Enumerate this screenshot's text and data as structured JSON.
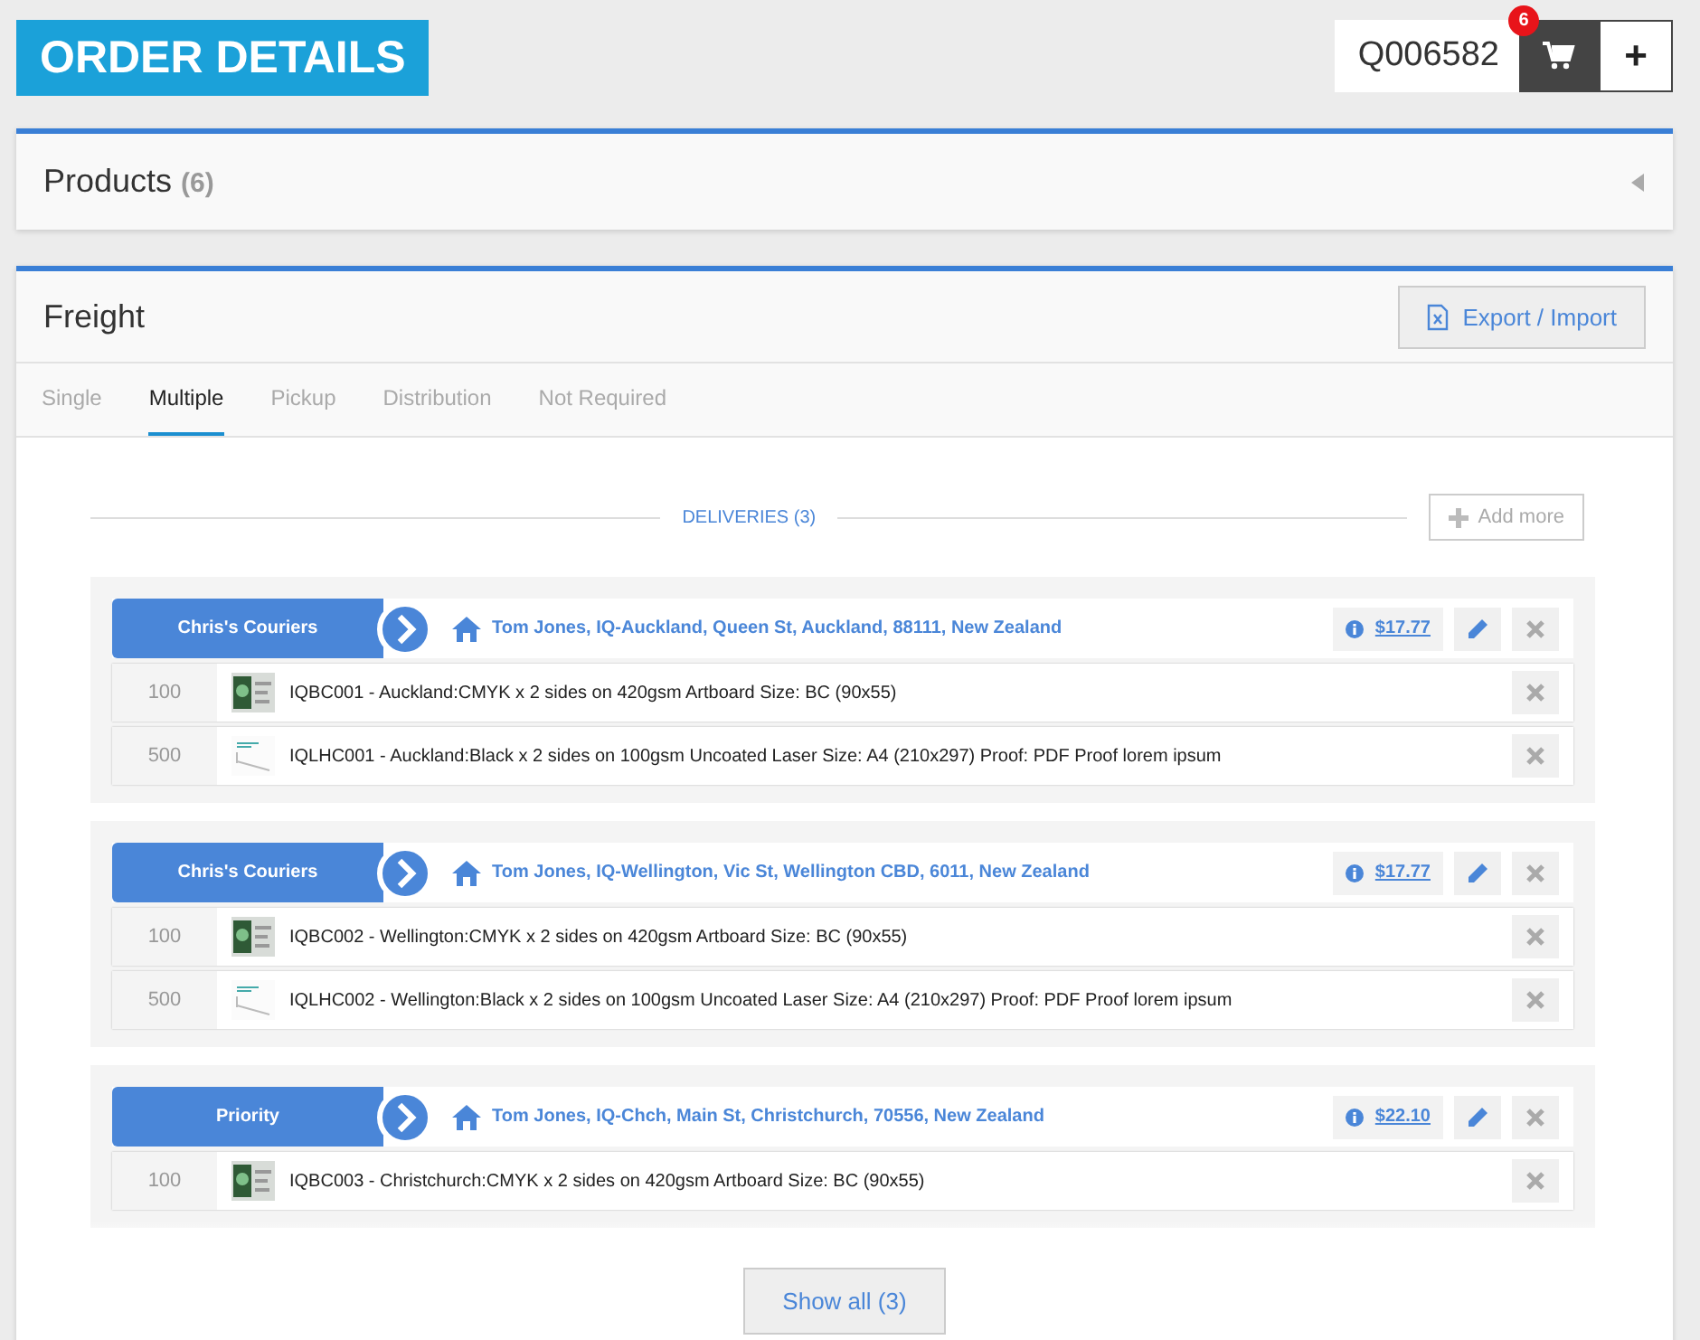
{
  "header": {
    "title": "ORDER DETAILS",
    "quote_number": "Q006582",
    "cart_count": "6",
    "add_label": "+"
  },
  "products_panel": {
    "title": "Products",
    "count": "(6)",
    "expanded": false
  },
  "freight_panel": {
    "title": "Freight",
    "export_button": "Export / Import",
    "tabs": [
      {
        "label": "Single",
        "selected": false
      },
      {
        "label": "Multiple",
        "selected": true
      },
      {
        "label": "Pickup",
        "selected": false
      },
      {
        "label": "Distribution",
        "selected": false
      },
      {
        "label": "Not Required",
        "selected": false
      }
    ],
    "deliveries_label": "DELIVERIES (3)",
    "add_more_button": "Add more",
    "deliveries": [
      {
        "carrier": "Chris's Couriers",
        "address": "Tom Jones, IQ-Auckland, Queen St, Auckland, 88111, New Zealand",
        "price": "$17.77",
        "items": [
          {
            "qty": "100",
            "kind": "card",
            "description": "IQBC001 - Auckland:CMYK x 2 sides on 420gsm Artboard Size: BC (90x55)"
          },
          {
            "qty": "500",
            "kind": "letterhead",
            "description": "IQLHC001 - Auckland:Black x 2 sides on 100gsm Uncoated Laser Size: A4 (210x297) Proof: PDF Proof lorem ipsum"
          }
        ]
      },
      {
        "carrier": "Chris's Couriers",
        "address": "Tom Jones, IQ-Wellington, Vic St, Wellington CBD, 6011, New Zealand",
        "price": "$17.77",
        "items": [
          {
            "qty": "100",
            "kind": "card",
            "description": "IQBC002 - Wellington:CMYK x 2 sides on 420gsm Artboard Size: BC (90x55)"
          },
          {
            "qty": "500",
            "kind": "letterhead",
            "description": "IQLHC002 - Wellington:Black x 2 sides on 100gsm Uncoated Laser Size: A4 (210x297) Proof: PDF Proof lorem ipsum"
          }
        ]
      },
      {
        "carrier": "Priority",
        "address": "Tom Jones, IQ-Chch, Main St, Christchurch, 70556, New Zealand",
        "price": "$22.10",
        "items": [
          {
            "qty": "100",
            "kind": "card",
            "description": "IQBC003 - Christchurch:CMYK x 2 sides on 420gsm Artboard Size: BC (90x55)"
          }
        ]
      }
    ],
    "show_all_button": "Show all (3)"
  }
}
